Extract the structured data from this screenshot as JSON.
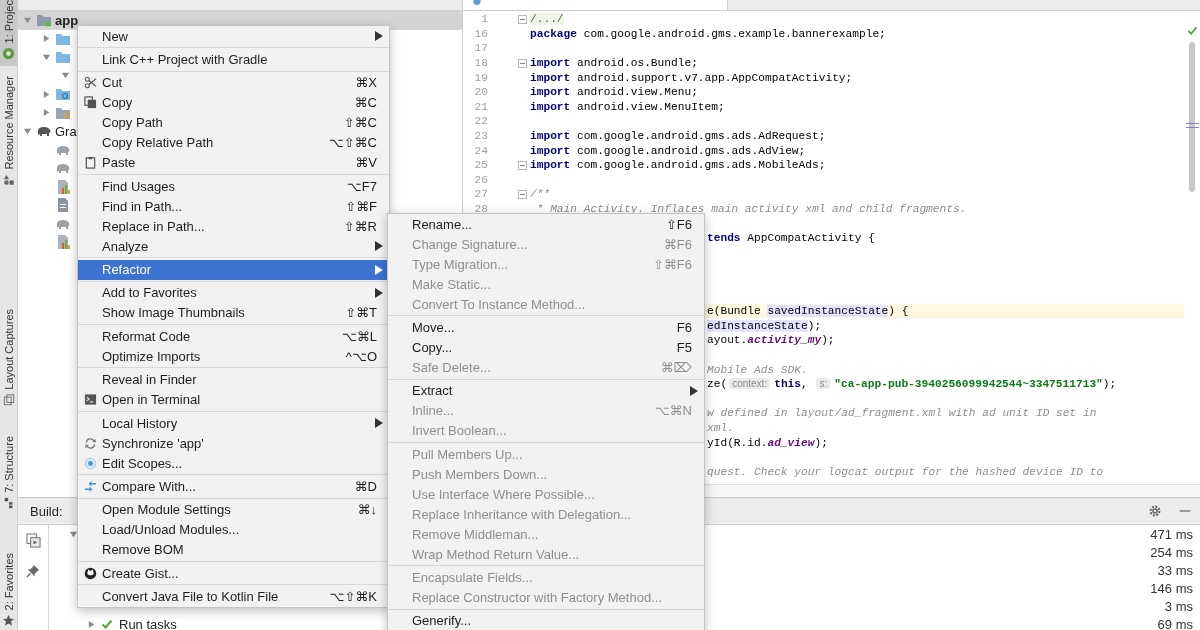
{
  "tool_strip": [
    {
      "label": "1: Projec",
      "selected": true
    },
    {
      "label": "Resource Manager",
      "selected": false
    },
    {
      "label": "Layout Captures",
      "selected": false
    },
    {
      "label": "7: Structure",
      "selected": false
    },
    {
      "label": "2: Favorites",
      "selected": false
    }
  ],
  "project": {
    "tree": [
      {
        "label": "app",
        "kind": "module",
        "expanded": true,
        "selected": true,
        "children": [
          {
            "kind": "folder",
            "expanded": false,
            "selected": false
          },
          {
            "kind": "folder",
            "expanded": true,
            "selected": false,
            "children": [
              {
                "expanded": true,
                "selected": false
              }
            ]
          },
          {
            "kind": "resource-folder",
            "expanded": false,
            "selected": false
          },
          {
            "kind": "list-folder",
            "expanded": false,
            "selected": false
          }
        ]
      },
      {
        "label": "Gra",
        "kind": "gradle",
        "expanded": true,
        "selected": false,
        "children": [
          {
            "kind": "gradle",
            "selected": false
          },
          {
            "kind": "gradle",
            "selected": false
          },
          {
            "kind": "chart-file",
            "selected": false
          },
          {
            "kind": "doc-file",
            "selected": false
          },
          {
            "kind": "gradle",
            "selected": false
          },
          {
            "kind": "chart-file",
            "selected": false
          }
        ]
      }
    ]
  },
  "editor": {
    "lines": [
      {
        "kind": "full",
        "number": "1",
        "fold": true,
        "tokens": [
          {
            "kind": "folded",
            "text": "/.../"
          }
        ]
      },
      {
        "kind": "full",
        "number": "16",
        "fold": false,
        "tokens": [
          {
            "kind": "kw",
            "text": "package"
          },
          {
            "kind": "plain",
            "text": " com.google.android.gms.example.bannerexample;"
          }
        ]
      },
      {
        "kind": "full",
        "number": "17",
        "fold": false
      },
      {
        "kind": "full",
        "number": "18",
        "fold": true,
        "tokens": [
          {
            "kind": "kw",
            "text": "import"
          },
          {
            "kind": "plain",
            "text": " android.os.Bundle;"
          }
        ]
      },
      {
        "kind": "full",
        "number": "19",
        "fold": false,
        "tokens": [
          {
            "kind": "kw",
            "text": "import"
          },
          {
            "kind": "plain",
            "text": " android.support.v7.app.AppCompatActivity;"
          }
        ]
      },
      {
        "kind": "full",
        "number": "20",
        "fold": false,
        "tokens": [
          {
            "kind": "kw",
            "text": "import"
          },
          {
            "kind": "plain",
            "text": " android.view.Menu;"
          }
        ]
      },
      {
        "kind": "full",
        "number": "21",
        "fold": false,
        "tokens": [
          {
            "kind": "kw",
            "text": "import"
          },
          {
            "kind": "plain",
            "text": " android.view.MenuItem;"
          }
        ]
      },
      {
        "kind": "full",
        "number": "22",
        "fold": false
      },
      {
        "kind": "full",
        "number": "23",
        "fold": false,
        "tokens": [
          {
            "kind": "kw",
            "text": "import"
          },
          {
            "kind": "plain",
            "text": " com.google.android.gms.ads.AdRequest;"
          }
        ]
      },
      {
        "kind": "full",
        "number": "24",
        "fold": false,
        "tokens": [
          {
            "kind": "kw",
            "text": "import"
          },
          {
            "kind": "plain",
            "text": " com.google.android.gms.ads.AdView;"
          }
        ]
      },
      {
        "kind": "full",
        "number": "25",
        "fold": true,
        "tokens": [
          {
            "kind": "kw",
            "text": "import"
          },
          {
            "kind": "plain",
            "text": " com.google.android.gms.ads.MobileAds;"
          }
        ]
      },
      {
        "kind": "full",
        "number": "26",
        "fold": false
      },
      {
        "kind": "full",
        "number": "27",
        "fold": true,
        "tokens": [
          {
            "kind": "comment",
            "text": "/**"
          }
        ]
      },
      {
        "kind": "full",
        "number": "28",
        "fold": false,
        "tokens": [
          {
            "kind": "comment",
            "text": " * Main Activity. Inflates main activity xml and child fragments."
          }
        ]
      },
      {
        "kind": "tail"
      },
      {
        "kind": "tail",
        "tokens": [
          {
            "kind": "kw",
            "text": "tends"
          },
          {
            "kind": "plain",
            "text": " AppCompatActivity {"
          }
        ]
      },
      {
        "kind": "tail"
      },
      {
        "kind": "tail"
      },
      {
        "kind": "tail"
      },
      {
        "kind": "tail"
      },
      {
        "kind": "tail",
        "current": true,
        "tokens": [
          {
            "kind": "plain",
            "text": "e(Bundle "
          },
          {
            "kind": "highlight",
            "text": "savedInstanceState"
          },
          {
            "kind": "plain",
            "text": ") {"
          }
        ]
      },
      {
        "kind": "tail",
        "tokens": [
          {
            "kind": "highlight",
            "text": "edInstanceState"
          },
          {
            "kind": "plain",
            "text": ");"
          }
        ]
      },
      {
        "kind": "tail",
        "tokens": [
          {
            "kind": "plain",
            "text": "ayout."
          },
          {
            "kind": "field",
            "text": "activity_my"
          },
          {
            "kind": "plain",
            "text": ");"
          }
        ]
      },
      {
        "kind": "tail"
      },
      {
        "kind": "tail",
        "tokens": [
          {
            "kind": "comment",
            "text": "Mobile Ads SDK."
          }
        ]
      },
      {
        "kind": "tail",
        "tokens": [
          {
            "kind": "plain",
            "text": "ze("
          },
          {
            "kind": "hint",
            "text": "context:"
          },
          {
            "kind": "kw",
            "text": "this"
          },
          {
            "kind": "plain",
            "text": ", "
          },
          {
            "kind": "hint",
            "text": "s:"
          },
          {
            "kind": "string",
            "text": "\"ca-app-pub-3940256099942544~3347511713\""
          },
          {
            "kind": "plain",
            "text": ");"
          }
        ]
      },
      {
        "kind": "tail"
      },
      {
        "kind": "tail",
        "tokens": [
          {
            "kind": "comment",
            "text": "w defined in layout/ad_fragment.xml with ad unit ID set in"
          }
        ]
      },
      {
        "kind": "tail",
        "tokens": [
          {
            "kind": "comment",
            "text": "xml."
          }
        ]
      },
      {
        "kind": "tail",
        "tokens": [
          {
            "kind": "plain",
            "text": "yId(R.id."
          },
          {
            "kind": "field",
            "text": "ad_view"
          },
          {
            "kind": "plain",
            "text": ");"
          }
        ]
      },
      {
        "kind": "tail"
      },
      {
        "kind": "tail",
        "tokens": [
          {
            "kind": "comment",
            "text": "quest. Check your logcat output for the hashed device ID to"
          }
        ]
      }
    ]
  },
  "build": {
    "title": "Build:",
    "rows": [
      {
        "time": "471 ms",
        "expanded": true,
        "children": [
          {
            "time": "254 ms"
          },
          {
            "time": "33 ms"
          },
          {
            "time": "146 ms"
          },
          {
            "time": "3 ms"
          },
          {
            "time": "69 ms",
            "label": "Run tasks",
            "expanded": false
          }
        ]
      }
    ]
  },
  "context_menu": {
    "groups": [
      {
        "items": [
          {
            "label": "New",
            "submenu": true,
            "selected": false
          }
        ]
      },
      {
        "items": [
          {
            "label": "Link C++ Project with Gradle",
            "selected": false
          }
        ]
      },
      {
        "items": [
          {
            "label": "Cut",
            "shortcut": "⌘X",
            "selected": false
          },
          {
            "label": "Copy",
            "shortcut": "⌘C",
            "selected": false
          },
          {
            "label": "Copy Path",
            "shortcut": "⇧⌘C",
            "selected": false
          },
          {
            "label": "Copy Relative Path",
            "shortcut": "⌥⇧⌘C",
            "selected": false
          },
          {
            "label": "Paste",
            "shortcut": "⌘V",
            "selected": false
          }
        ]
      },
      {
        "items": [
          {
            "label": "Find Usages",
            "shortcut": "⌥F7",
            "selected": false
          },
          {
            "label": "Find in Path...",
            "shortcut": "⇧⌘F",
            "selected": false
          },
          {
            "label": "Replace in Path...",
            "shortcut": "⇧⌘R",
            "selected": false
          },
          {
            "label": "Analyze",
            "submenu": true,
            "selected": false
          }
        ]
      },
      {
        "items": [
          {
            "label": "Refactor",
            "submenu": true,
            "selected": true
          }
        ]
      },
      {
        "items": [
          {
            "label": "Add to Favorites",
            "submenu": true,
            "selected": false
          },
          {
            "label": "Show Image Thumbnails",
            "shortcut": "⇧⌘T",
            "selected": false
          }
        ]
      },
      {
        "items": [
          {
            "label": "Reformat Code",
            "shortcut": "⌥⌘L",
            "selected": false
          },
          {
            "label": "Optimize Imports",
            "shortcut": "^⌥O",
            "selected": false
          }
        ]
      },
      {
        "items": [
          {
            "label": "Reveal in Finder",
            "selected": false
          },
          {
            "label": "Open in Terminal",
            "selected": false
          }
        ]
      },
      {
        "items": [
          {
            "label": "Local History",
            "submenu": true,
            "selected": false
          },
          {
            "label": "Synchronize 'app'",
            "selected": false
          },
          {
            "label": "Edit Scopes...",
            "selected": false
          }
        ]
      },
      {
        "items": [
          {
            "label": "Compare With...",
            "shortcut": "⌘D",
            "selected": false
          }
        ]
      },
      {
        "items": [
          {
            "label": "Open Module Settings",
            "shortcut": "⌘↓",
            "selected": false
          },
          {
            "label": "Load/Unload Modules...",
            "selected": false
          },
          {
            "label": "Remove BOM",
            "selected": false
          }
        ]
      },
      {
        "items": [
          {
            "label": "Create Gist...",
            "selected": false
          }
        ]
      },
      {
        "items": [
          {
            "label": "Convert Java File to Kotlin File",
            "shortcut": "⌥⇧⌘K",
            "selected": false
          }
        ]
      }
    ]
  },
  "refactor_submenu": {
    "groups": [
      {
        "items": [
          {
            "label": "Rename...",
            "shortcut": "⇧F6",
            "disabled": false
          },
          {
            "label": "Change Signature...",
            "shortcut": "⌘F6",
            "disabled": true
          },
          {
            "label": "Type Migration...",
            "shortcut": "⇧⌘F6",
            "disabled": true
          },
          {
            "label": "Make Static...",
            "disabled": true
          },
          {
            "label": "Convert To Instance Method...",
            "disabled": true
          }
        ]
      },
      {
        "items": [
          {
            "label": "Move...",
            "shortcut": "F6",
            "disabled": false
          },
          {
            "label": "Copy...",
            "shortcut": "F5",
            "disabled": false
          },
          {
            "label": "Safe Delete...",
            "shortcut": "⌘⌦",
            "disabled": true
          }
        ]
      },
      {
        "items": [
          {
            "label": "Extract",
            "submenu": true,
            "disabled": false
          },
          {
            "label": "Inline...",
            "shortcut": "⌥⌘N",
            "disabled": true
          },
          {
            "label": "Invert Boolean...",
            "disabled": true
          }
        ]
      },
      {
        "items": [
          {
            "label": "Pull Members Up...",
            "disabled": true
          },
          {
            "label": "Push Members Down...",
            "disabled": true
          },
          {
            "label": "Use Interface Where Possible...",
            "disabled": true
          },
          {
            "label": "Replace Inheritance with Delegation...",
            "disabled": true
          },
          {
            "label": "Remove Middleman...",
            "disabled": true
          },
          {
            "label": "Wrap Method Return Value...",
            "disabled": true
          }
        ]
      },
      {
        "items": [
          {
            "label": "Encapsulate Fields...",
            "disabled": true
          },
          {
            "label": "Replace Constructor with Factory Method...",
            "disabled": true
          }
        ]
      },
      {
        "items": [
          {
            "label": "Generify...",
            "disabled": false
          }
        ]
      }
    ]
  }
}
